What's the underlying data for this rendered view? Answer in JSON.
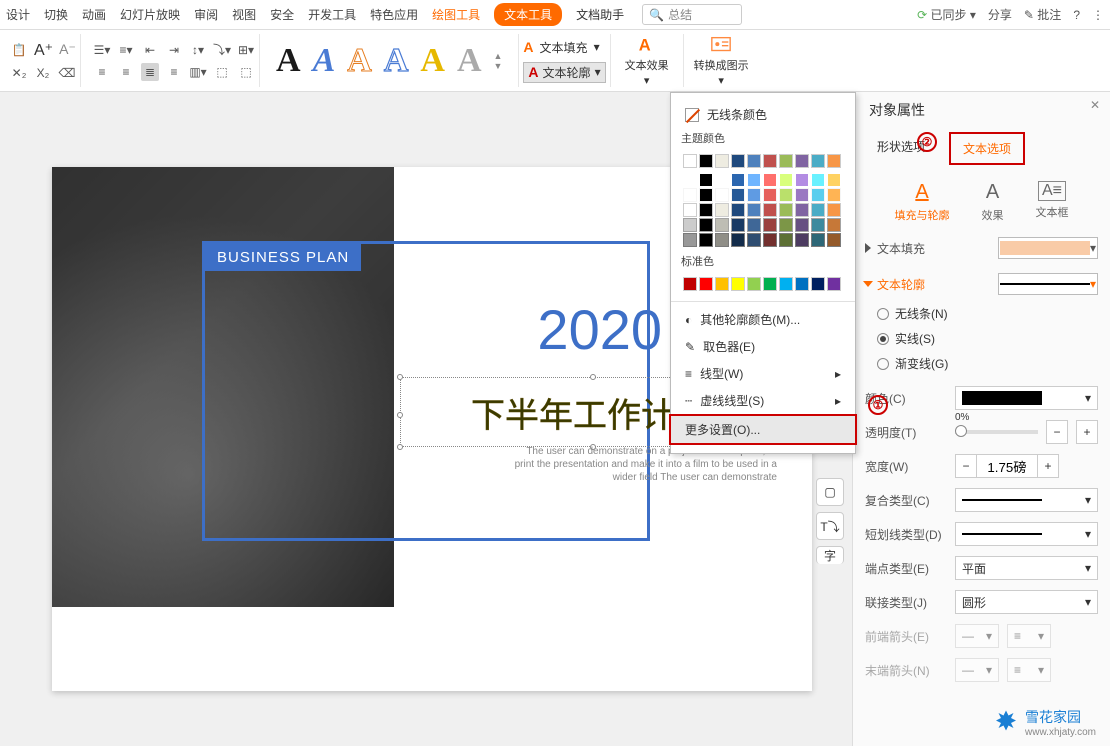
{
  "menubar": {
    "items": [
      "设计",
      "切换",
      "动画",
      "幻灯片放映",
      "审阅",
      "视图",
      "安全",
      "开发工具",
      "特色应用",
      "绘图工具",
      "文本工具",
      "文档助手"
    ],
    "search_placeholder": "总结",
    "sync": "已同步",
    "share": "分享",
    "annotate": "批注"
  },
  "toolbar": {
    "text_fill": "文本填充",
    "text_outline": "文本轮廓",
    "text_effect": "文本效果",
    "convert_chart": "转换成图示"
  },
  "dropdown": {
    "no_line": "无线条颜色",
    "theme_header": "主题颜色",
    "standard_header": "标准色",
    "more_colors": "其他轮廓颜色(M)...",
    "eyedropper": "取色器(E)",
    "line_style": "线型(W)",
    "dash_style": "虚线线型(S)",
    "more_settings": "更多设置(O)...",
    "theme_base": [
      "#ffffff",
      "#000000",
      "#eeece1",
      "#1f497d",
      "#4f81bd",
      "#c0504d",
      "#9bbb59",
      "#8064a2",
      "#4bacc6",
      "#f79646"
    ],
    "standard": [
      "#c00000",
      "#ff0000",
      "#ffc000",
      "#ffff00",
      "#92d050",
      "#00b050",
      "#00b0f0",
      "#0070c0",
      "#002060",
      "#7030a0"
    ]
  },
  "slide": {
    "badge": "BUSINESS PLAN",
    "year": "2020",
    "title": "下半年工作计划",
    "subtitle": "The user can demonstrate on a projector or computer, or print the presentation and make it into a film to be used in a wider field The user can demonstrate"
  },
  "panel": {
    "title": "对象属性",
    "shape_options": "形状选项",
    "text_options": "文本选项",
    "tab_fill": "填充与轮廓",
    "tab_effect": "效果",
    "tab_textbox": "文本框",
    "sec_fill": "文本填充",
    "sec_outline": "文本轮廓",
    "no_line": "无线条(N)",
    "solid": "实线(S)",
    "gradient": "渐变线(G)",
    "color": "颜色(C)",
    "transparency": "透明度(T)",
    "transparency_val": "0%",
    "width": "宽度(W)",
    "width_val": "1.75磅",
    "compound": "复合类型(C)",
    "dash": "短划线类型(D)",
    "cap": "端点类型(E)",
    "cap_val": "平面",
    "join": "联接类型(J)",
    "join_val": "圆形",
    "arrow_start": "前端箭头(E)",
    "arrow_end": "末端箭头(N)"
  },
  "markers": {
    "one": "①",
    "two": "②"
  },
  "watermark": {
    "name": "雪花家园",
    "url": "www.xhjaty.com"
  }
}
